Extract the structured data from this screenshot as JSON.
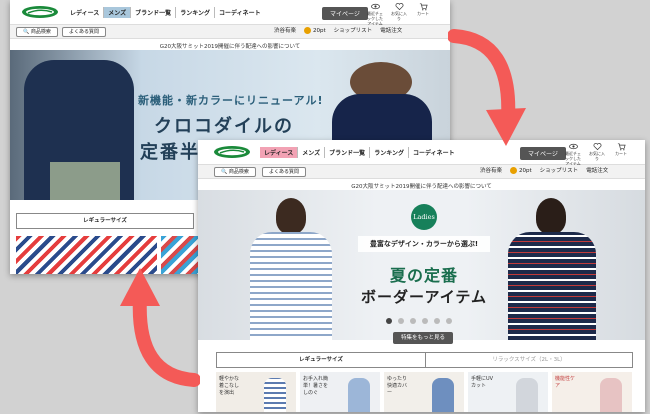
{
  "back_window": {
    "nav": [
      "レディース",
      "メンズ",
      "ブランド一覧",
      "ランキング",
      "コーディネート"
    ],
    "nav_active": "メンズ",
    "mypage": "マイページ",
    "top_icons": [
      "最近チェックしたアイテム",
      "お気に入り",
      "カート"
    ],
    "search_pill": "商品検索",
    "faq_pill": "よくある質問",
    "store": "渋谷有楽",
    "points": "20pt",
    "shoplist": "ショップリスト",
    "phone": "電話注文",
    "notice": "G20大阪サミット2019開催に伴う配達への影響について",
    "hero_line1": "新機能・新カラーにリニューアル!",
    "hero_line2": "クロコダイルの",
    "hero_line3": "定番半袖",
    "category_tab": "レギュラーサイズ"
  },
  "front_window": {
    "nav": [
      "レディース",
      "メンズ",
      "ブランド一覧",
      "ランキング",
      "コーディネート"
    ],
    "nav_active": "レディース",
    "mypage": "マイページ",
    "top_icons": [
      "最近チェックしたアイテム",
      "お気に入り",
      "カート"
    ],
    "search_pill": "商品検索",
    "faq_pill": "よくある質問",
    "store": "渋谷有楽",
    "points": "20pt",
    "shoplist": "ショップリスト",
    "phone": "電話注文",
    "notice": "G20大阪サミット2019開催に伴う配達への影響について",
    "badge": "Ladies",
    "hero_sub": "豊富なデザイン・カラーから選ぶ!",
    "hero_title1": "夏の定番",
    "hero_title2": "ボーダーアイテム",
    "cta": "特集をもっと見る",
    "tab_regular": "レギュラーサイズ",
    "tab_relax": "リラックスサイズ（2L・3L）",
    "cards": [
      {
        "label": "軽やかな着こなしを演出"
      },
      {
        "label": "お手入れ簡単！暑さをしのぐ"
      },
      {
        "label": "ゆったり快適カバー"
      },
      {
        "label": "手軽にUVカット"
      },
      {
        "label": "機能性ケア"
      }
    ]
  },
  "colors": {
    "accent": "#f45a57",
    "brand_green": "#1a8a3a",
    "mypage_bg": "#555555"
  }
}
